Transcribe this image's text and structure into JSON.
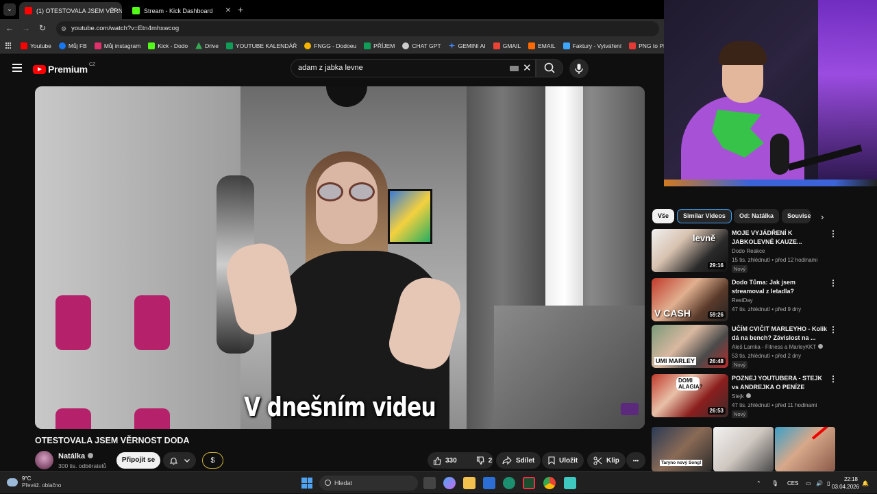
{
  "browser": {
    "tabs": [
      {
        "label": "(1) OTESTOVALA JSEM VĚRNOS",
        "active": true,
        "favicon_color": "#ff0000"
      },
      {
        "label": "Stream - Kick Dashboard",
        "active": false,
        "favicon_color": "#53fc18"
      }
    ],
    "new_tab_label": "+",
    "address": "youtube.com/watch?v=Etn4mhxwcog",
    "bookmarks": [
      {
        "label": "Youtube",
        "color": "#ff0000"
      },
      {
        "label": "Můj FB",
        "color": "#1877f2"
      },
      {
        "label": "Můj instagram",
        "color": "#e1306c"
      },
      {
        "label": "Kick - Dodo",
        "color": "#53fc18"
      },
      {
        "label": "Drive",
        "color": "#34a853"
      },
      {
        "label": "YOUTUBE KALENDÁŘ",
        "color": "#0f9d58"
      },
      {
        "label": "FNGG - Dodoeu",
        "color": "#f4b400"
      },
      {
        "label": "PŘÍJEM",
        "color": "#0f9d58"
      },
      {
        "label": "CHAT GPT",
        "color": "#cccccc"
      },
      {
        "label": "GEMINI AI",
        "color": "#4285f4"
      },
      {
        "label": "GMAIL",
        "color": "#ea4335"
      },
      {
        "label": "EMAIL",
        "color": "#ff6a00"
      },
      {
        "label": "Faktury - Vytváření",
        "color": "#3ea6ff"
      },
      {
        "label": "PNG to PDF",
        "color": "#e53935"
      }
    ]
  },
  "youtube": {
    "logo_text": "Premium",
    "logo_region": "CZ",
    "search_query": "adam z jabka levne",
    "subtitle": "V dnešním videu",
    "video_title": "OTESTOVALA JSEM VĚRNOST DODA",
    "channel": {
      "name": "Natálka",
      "subscribers": "300 tis. odběratelů"
    },
    "join_label": "Připojit se",
    "dollar_label": "$",
    "likes": "330",
    "dislikes": "2",
    "share_label": "Sdílet",
    "save_label": "Uložit",
    "clip_label": "Klip",
    "more_label": "•••"
  },
  "sidebar": {
    "chips": [
      "Vše",
      "Similar Videos",
      "Od: Natálka",
      "Souvisej"
    ],
    "recommendations": [
      {
        "title": "MOJE VYJÁDŘENÍ K JABKOLEVNÉ KAUZE...",
        "channel": "Dodo Reakce",
        "meta": "15 tis. zhlédnutí • před 12 hodinami",
        "badge": "Nový",
        "duration": "29:16",
        "thumb_text": "levně",
        "verified": false
      },
      {
        "title": "Dodo Tůma: Jak jsem streamoval z letadla?",
        "channel": "RestDay",
        "meta": "47 tis. zhlédnutí • před 9 dny",
        "badge": "",
        "duration": "59:26",
        "thumb_text": "V CASH",
        "verified": false
      },
      {
        "title": "UČÍM CVIČIT MARLEYHO - Kolik dá na bench? Závislost na ...",
        "channel": "Aleš Lamka - Fitness a MarleyKKT",
        "meta": "53 tis. zhlédnutí • před 2 dny",
        "badge": "Nový",
        "duration": "26:48",
        "thumb_text": "UMI MARLEY",
        "verified": true
      },
      {
        "title": "POZNEJ YOUTUBERA - STEJK vs ANDREJKA O PENÍZE",
        "channel": "Stejk",
        "meta": "47 tis. zhlédnutí • před 11 hodinami",
        "badge": "Nový",
        "duration": "26:53",
        "thumb_text": "DOMI ALAGIA?",
        "verified": true
      }
    ],
    "short_caption": "Taryno nový Song!"
  },
  "taskbar": {
    "temperature": "9°C",
    "weather": "Převáž. oblačno",
    "search_placeholder": "Hledat",
    "language": "CES",
    "time": "22:18",
    "date": "03.04.2026"
  }
}
